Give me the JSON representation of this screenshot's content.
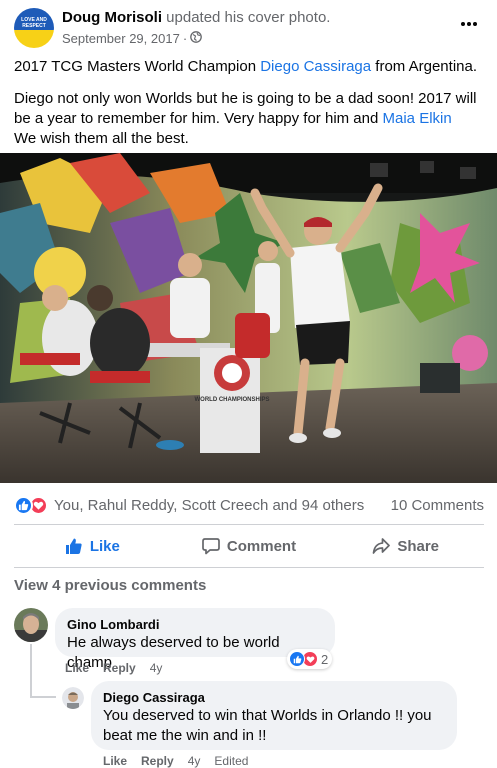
{
  "post": {
    "author_name": "Doug Morisoli",
    "action_text": "updated his cover photo.",
    "date": "September 29, 2017",
    "date_separator": "·",
    "avatar_text": "LOVE AND RESPECT",
    "more_icon": "more-horizontal-icon",
    "text_line1_before": "2017 TCG Masters World Champion",
    "text_line1_link": "Diego Cassiraga",
    "text_line1_after": "from Argentina.",
    "text_p2_before": "Diego not only won Worlds but he is going to be a dad soon!  2017 will be a year to remember for him. Very happy for him and",
    "text_p2_link": "Maia Elkin",
    "text_p2_after": "We wish them all the best."
  },
  "photo": {
    "stage_sign": "WORLD CHAMPIONSHIPS"
  },
  "stats": {
    "reactors": "You, Rahul Reddy, Scott Creech and 94 others",
    "comments": "10 Comments"
  },
  "actions": {
    "like": "Like",
    "comment": "Comment",
    "share": "Share"
  },
  "comments": {
    "view_previous": "View 4 previous comments",
    "items": [
      {
        "name": "Gino Lombardi",
        "text": "He always deserved to be world champ",
        "like": "Like",
        "reply": "Reply",
        "time": "4y",
        "reaction_count": "2"
      },
      {
        "name": "Diego Cassiraga",
        "text": "You deserved to win that Worlds in Orlando !! you beat me the win and in !!",
        "like": "Like",
        "reply": "Reply",
        "time": "4y",
        "edited": "Edited"
      }
    ]
  },
  "colors": {
    "link": "#1b74e4",
    "secondary_text": "#65676b",
    "like_blue": "#1877f2",
    "love_red": "#f33e58",
    "bubble_bg": "#f0f2f5"
  }
}
